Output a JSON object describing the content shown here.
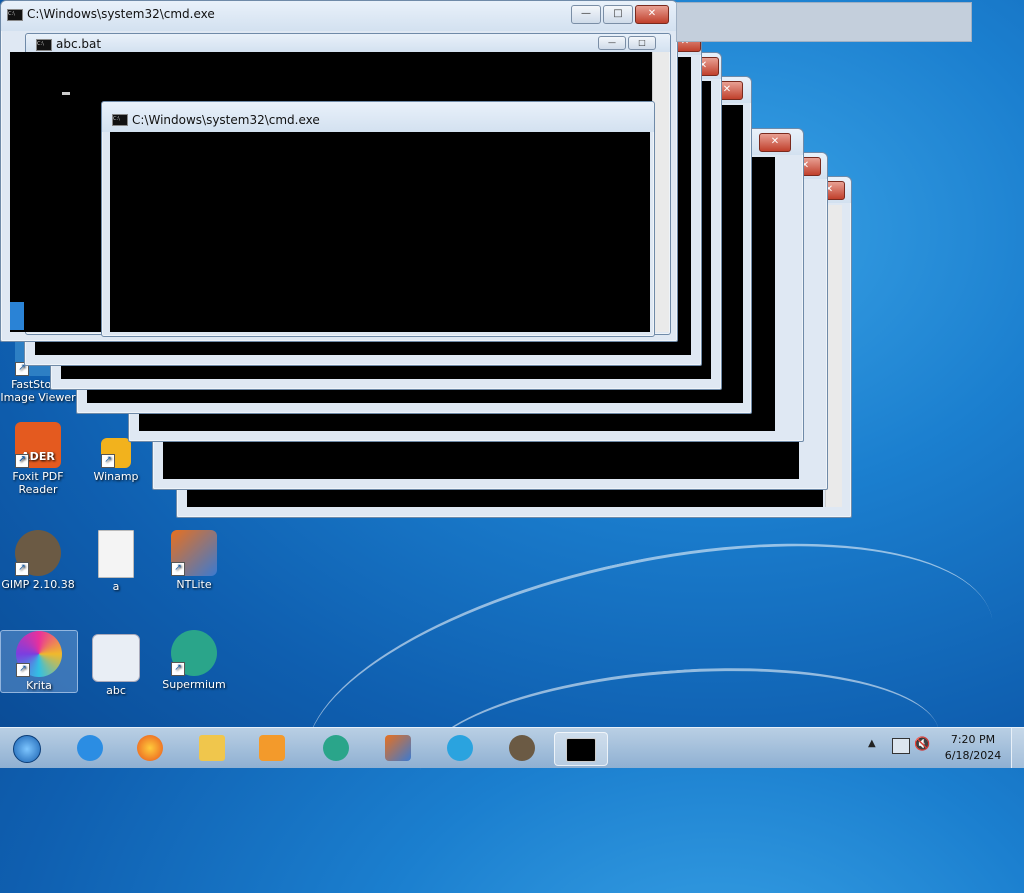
{
  "windows": {
    "cmd_front": {
      "title": "C:\\Windows\\system32\\cmd.exe"
    },
    "abc_bat": {
      "title": "abc.bat"
    },
    "cmd_inner": {
      "title": "C:\\Windows\\system32\\cmd.exe"
    },
    "controls": {
      "minimize": "—",
      "maximize": "□",
      "close": "✕"
    }
  },
  "desktop_icons": [
    {
      "label": "FastStone Image Viewer",
      "icon": "faststone-icon"
    },
    {
      "label": "Foxit PDF Reader",
      "icon": "foxit-icon"
    },
    {
      "label": "Winamp",
      "icon": "winamp-icon"
    },
    {
      "label": "GIMP 2.10.38",
      "icon": "gimp-icon"
    },
    {
      "label": "a",
      "icon": "text-file-icon"
    },
    {
      "label": "NTLite",
      "icon": "ntlite-icon"
    },
    {
      "label": "Krita",
      "icon": "krita-icon"
    },
    {
      "label": "abc",
      "icon": "batch-file-icon"
    },
    {
      "label": "Supermium",
      "icon": "supermium-icon"
    }
  ],
  "icon_texts": {
    "foxit": "ADER",
    "cmd": "C:\\"
  },
  "taskbar": {
    "pinned": [
      "start-orb-icon",
      "ie-icon",
      "firefox-icon",
      "explorer-icon",
      "media-player-icon",
      "supermium-icon",
      "ntlite-icon",
      "telegram-icon",
      "gimp-icon",
      "cmd-icon"
    ],
    "active_index": 9,
    "tray": [
      "show-hidden-icons",
      "network-icon",
      "volume-muted-icon"
    ],
    "time": "7:20 PM",
    "date": "6/18/2024"
  },
  "colors": {
    "console_bg": "#000000",
    "close_red": "#c0402c",
    "titlebar": "#dfe8f3"
  }
}
